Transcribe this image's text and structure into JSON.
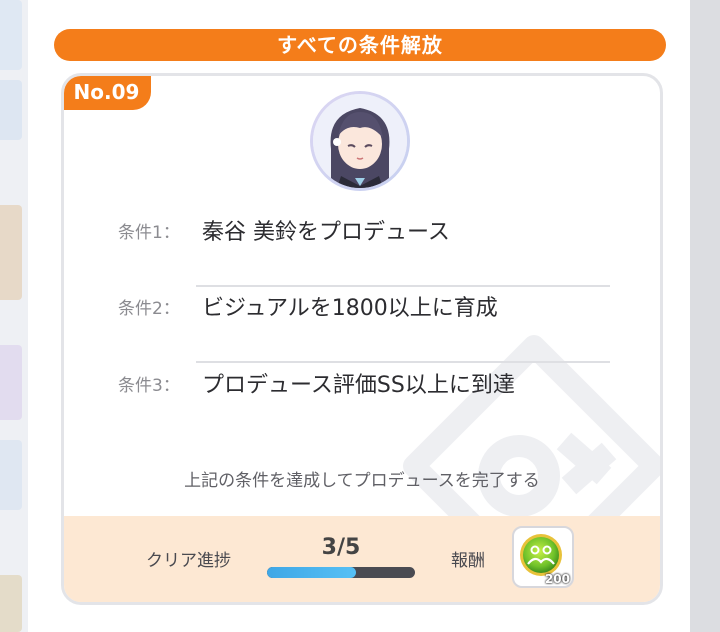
{
  "header": {
    "title": "すべての条件解放"
  },
  "card": {
    "number": "No.09"
  },
  "conditions": [
    {
      "label": "条件1：",
      "text": "秦谷 美鈴をプロデュース"
    },
    {
      "label": "条件2：",
      "text": "ビジュアルを1800以上に育成"
    },
    {
      "label": "条件3：",
      "text": "プロデュース評価SS以上に到達"
    }
  ],
  "footnote": "上記の条件を達成してプロデュースを完了する",
  "progress": {
    "label": "クリア進捗",
    "count": "3/5",
    "fraction": 0.6
  },
  "reward": {
    "label": "報酬",
    "icon": "green-coin-icon",
    "count": "200"
  },
  "colors": {
    "accent": "#f47d1a",
    "progress": "#3fa7e6",
    "reward_bg": "#fde8d3"
  }
}
